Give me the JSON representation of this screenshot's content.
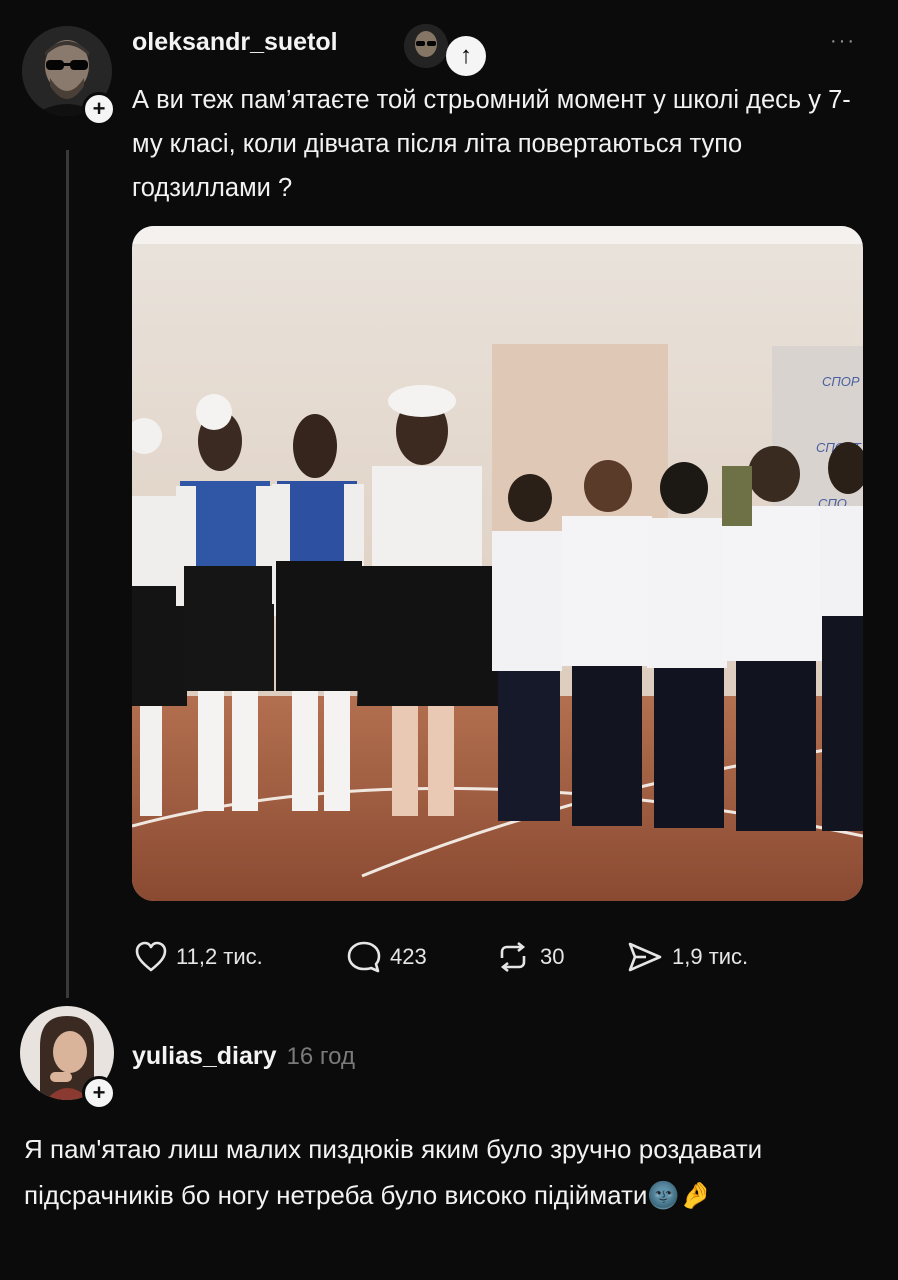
{
  "post": {
    "username": "oleksandr_suetol",
    "text": "А ви теж пам’ятаєте той стрьомний момент у школі десь у 7-му класі, коли дівчата після літа повертаються тупо годзиллами ?",
    "more_label": "···",
    "scroll_top_label": "↑",
    "add_label": "+"
  },
  "actions": {
    "likes": "11,2 тис.",
    "comments": "423",
    "reposts": "30",
    "shares": "1,9 тис."
  },
  "comment": {
    "username": "yulias_diary",
    "time": "16 год",
    "text": "Я пам'ятаю лиш малих пиздюків яким було зручно роздавати підсрачників бо ногу нетреба було високо підіймати",
    "emoji": "🌚🤌",
    "add_label": "+"
  },
  "photo": {
    "banner_words": [
      "СПОР",
      "СПОРТ",
      "СПО"
    ]
  },
  "colors": {
    "background": "#0b0b0b",
    "text": "#f2f2f2",
    "muted": "#7a7a7a"
  }
}
